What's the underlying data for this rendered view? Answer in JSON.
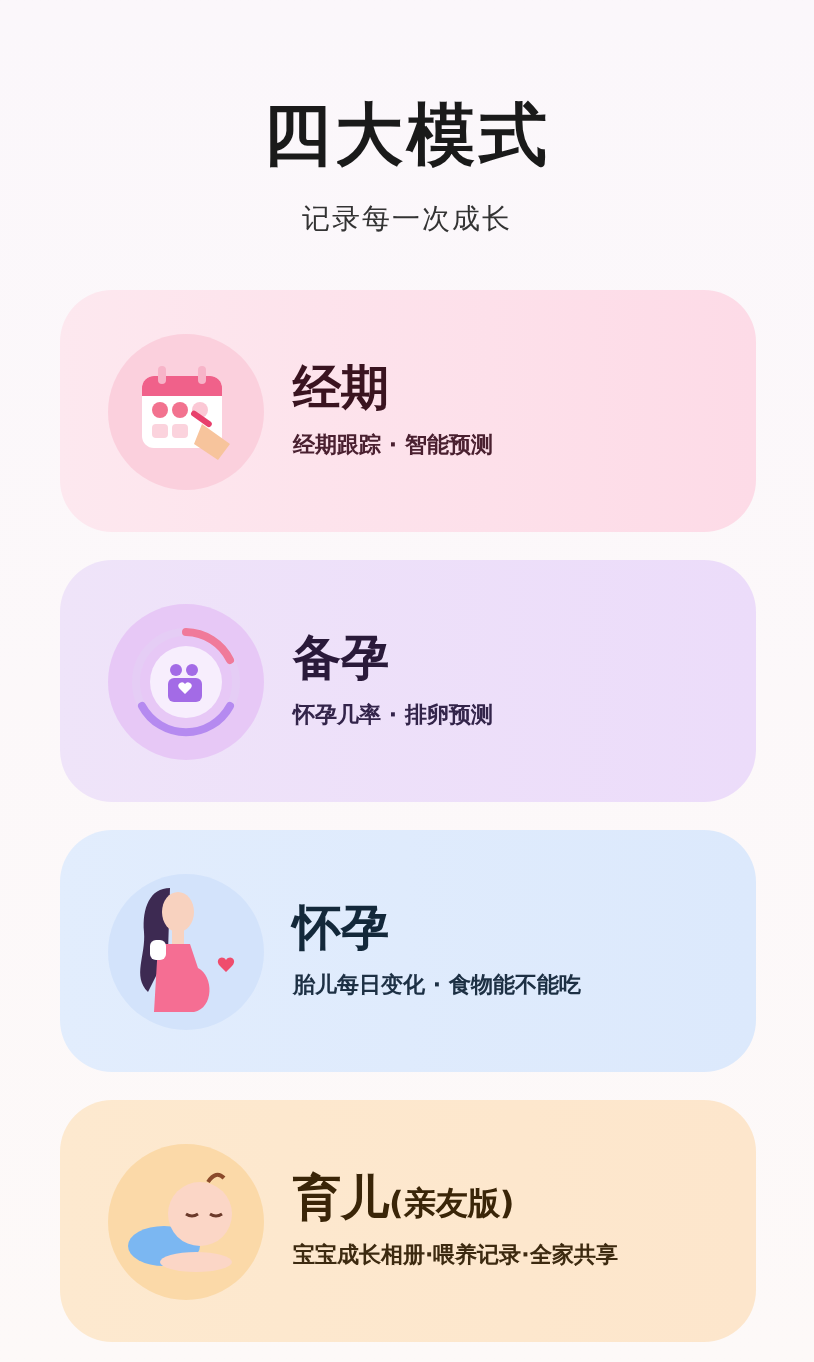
{
  "header": {
    "title": "四大模式",
    "subtitle": "记录每一次成长"
  },
  "modes": [
    {
      "kind": "period",
      "title": "经期",
      "description": "经期跟踪 · 智能预测"
    },
    {
      "kind": "conceive",
      "title": "备孕",
      "description": "怀孕几率 · 排卵预测"
    },
    {
      "kind": "pregnancy",
      "title": "怀孕",
      "description": "胎儿每日变化 · 食物能不能吃"
    },
    {
      "kind": "parenting",
      "title": "育儿",
      "suffix": "(亲友版)",
      "description": "宝宝成长相册·喂养记录·全家共享"
    }
  ]
}
